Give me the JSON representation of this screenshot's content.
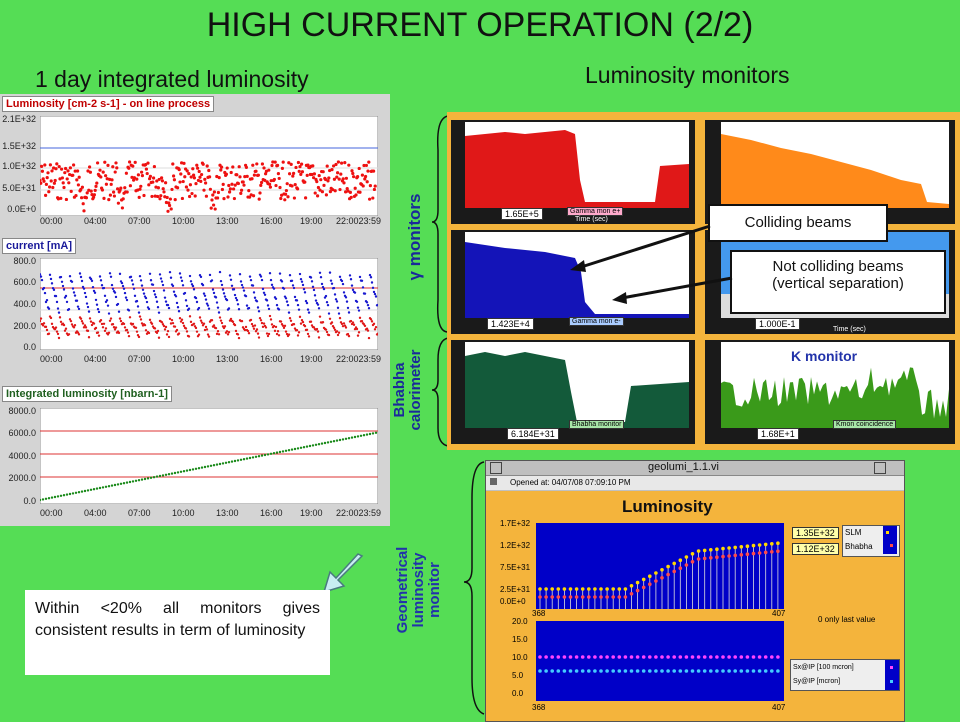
{
  "header": {
    "title": "HIGH CURRENT OPERATION (2/2)",
    "left_subtitle": "1 day integrated luminosity",
    "right_subtitle": "Luminosity monitors"
  },
  "left_charts": {
    "x_ticks": [
      "00:00",
      "04:00",
      "07:00",
      "10:00",
      "13:00",
      "16:00",
      "19:00",
      "22:0023:59"
    ],
    "luminosity": {
      "title": "Luminosity [cm-2 s-1] - on line process",
      "y_ticks": [
        "2.1E+32",
        "1.5E+32",
        "1.0E+32",
        "5.0E+31",
        "0.0E+0"
      ]
    },
    "current": {
      "title": "current [mA]",
      "y_ticks": [
        "800.0",
        "600.0",
        "400.0",
        "200.0",
        "0.0"
      ]
    },
    "integrated": {
      "title": "Integrated luminosity [nbarn-1]",
      "y_ticks": [
        "8000.0",
        "6000.0",
        "4000.0",
        "2000.0",
        "0.0"
      ]
    }
  },
  "vertical_labels": {
    "gamma": "γ monitors",
    "bhabha_line1": "Bhabha",
    "bhabha_line2": "calorimeter",
    "geo_line1": "Geometrical",
    "geo_line2": "luminosity",
    "geo_line3": "monitor"
  },
  "monitors": {
    "gamma_red_readout": "1.65E+5",
    "gamma_red_label": "Gamma mon e+",
    "gamma_blue_readout": "1.423E+4",
    "gamma_blue_label": "Gamma mon e-",
    "bhabha_readout": "6.184E+31",
    "bhabha_label": "Bhabha monitor",
    "k_readout": "1.68E+1",
    "k_label": "Kmon coincidence",
    "k_title": "K monitor",
    "right_blue_readout": "1.000E-1",
    "time_label": "Time (sec)"
  },
  "callouts": {
    "colliding": "Colliding beams",
    "not_colliding_line1": "Not colliding beams",
    "not_colliding_line2": "(vertical separation)"
  },
  "geolumi": {
    "window_title": "geolumi_1.1.vi",
    "opened_at": "Opened at: 04/07/08 07:09:10 PM",
    "chart_title": "Luminosity",
    "top_y_ticks": [
      "1.7E+32",
      "1.2E+32",
      "7.5E+31",
      "2.5E+31",
      "0.0E+0"
    ],
    "bottom_y_ticks": [
      "20.0",
      "15.0",
      "10.0",
      "5.0",
      "0.0"
    ],
    "x_start": "368",
    "x_end": "407",
    "readout_slm": "1.35E+32",
    "readout_bhabha": "1.12E+32",
    "legend_slm": "SLM",
    "legend_bhabha": "Bhabha",
    "only_last_value": "0 only last value",
    "legend_sx": "Sx@IP [100 mcron]",
    "legend_sy": "Sy@IP [mcron]"
  },
  "note": {
    "text": "Within <20% all monitors gives consistent results in term of luminosity"
  }
}
